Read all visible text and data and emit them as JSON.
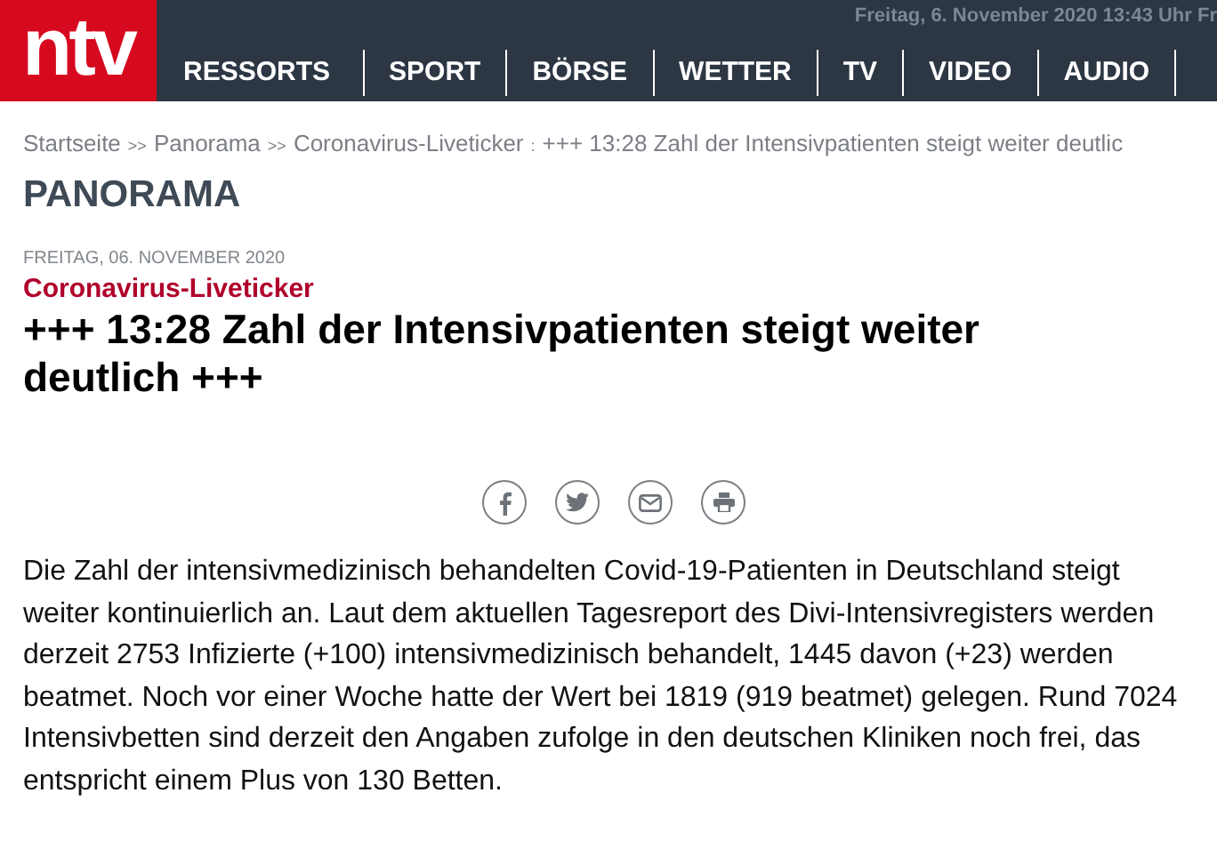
{
  "header": {
    "logo": "ntv",
    "date": "Freitag, 6. November 2020 13:43 Uhr Fr",
    "nav": [
      "RESSORTS",
      "SPORT",
      "BÖRSE",
      "WETTER",
      "TV",
      "VIDEO",
      "AUDIO"
    ]
  },
  "breadcrumb": [
    {
      "label": "Startseite",
      "sep": ">>"
    },
    {
      "label": "Panorama",
      "sep": ">>"
    },
    {
      "label": "Coronavirus-Liveticker",
      "sep": ":"
    },
    {
      "label": "+++ 13:28 Zahl der Intensivpatienten steigt weiter deutlic"
    }
  ],
  "section": "PANORAMA",
  "article": {
    "date": "FREITAG, 06. NOVEMBER 2020",
    "kicker": "Coronavirus-Liveticker",
    "headline": "+++ 13:28 Zahl der Intensivpatienten steigt weiter deutlich +++",
    "share": [
      {
        "kind": "facebook"
      },
      {
        "kind": "twitter"
      },
      {
        "kind": "mail"
      },
      {
        "kind": "print"
      }
    ],
    "body": "Die Zahl der intensivmedizinisch behandelten Covid-19-Patienten in Deutschland steigt weiter kontinuierlich an. Laut dem aktuellen Tagesreport des Divi-Intensivregisters werden derzeit 2753 Infizierte (+100) intensivmedizinisch behandelt, 1445 davon (+23) werden beatmet. Noch vor einer Woche hatte der Wert bei 1819 (919 beatmet) gelegen. Rund 7024 Intensivbetten sind derzeit den Angaben zufolge in den deutschen Kliniken noch frei, das entspricht einem Plus von 130 Betten."
  }
}
